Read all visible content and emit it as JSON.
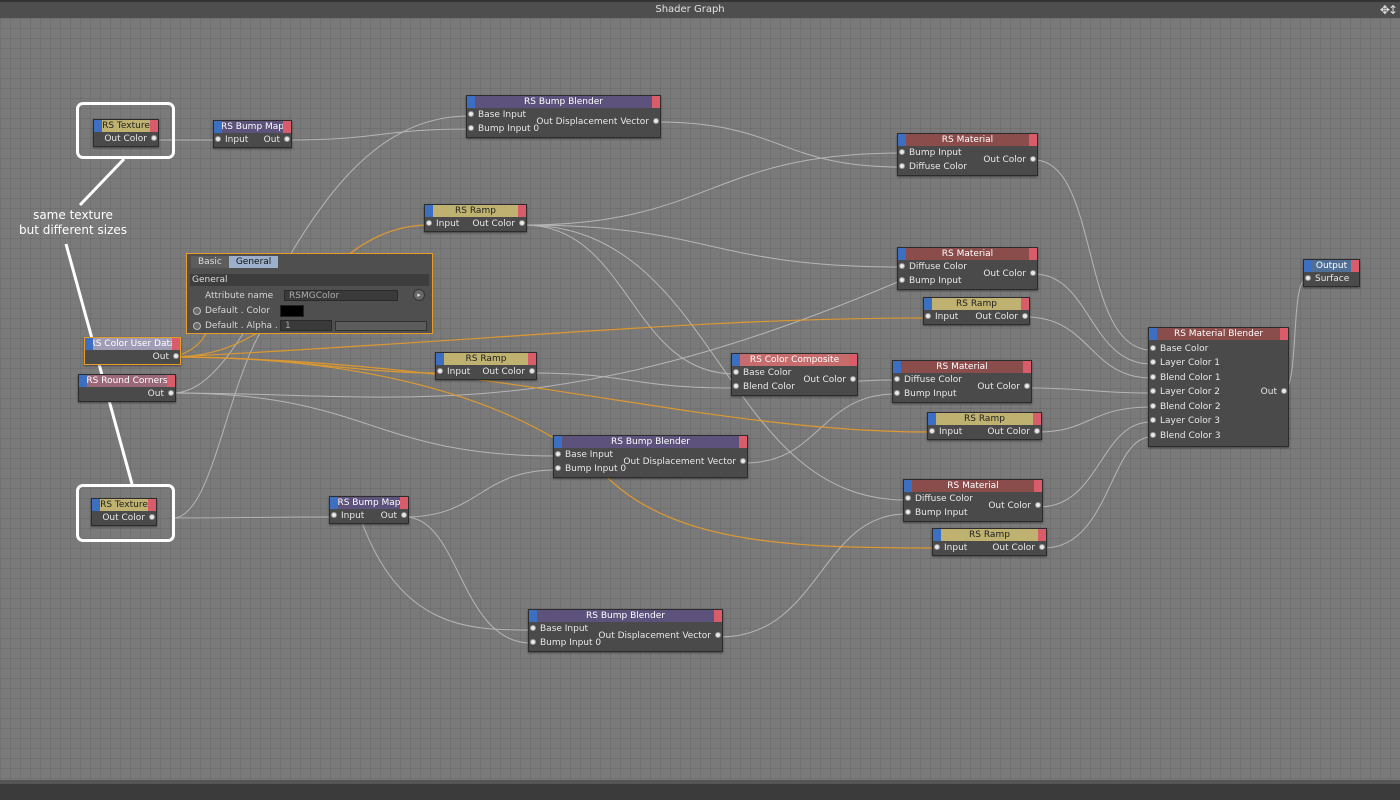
{
  "window": {
    "title": "Shader Graph"
  },
  "annotation": {
    "line1": "same texture",
    "line2": "but different sizes"
  },
  "attr_panel": {
    "tabs": [
      "Basic",
      "General"
    ],
    "section": "General",
    "attribute_name_label": "Attribute name",
    "attribute_name_value": "RSMGColor",
    "default_color_label": "Default . Color",
    "default_alpha_label": "Default . Alpha .",
    "default_alpha_value": "1"
  },
  "nodes": {
    "tex1": {
      "title": "RS Texture",
      "out": "Out Color"
    },
    "tex2": {
      "title": "RS Texture",
      "out": "Out Color"
    },
    "bumpmap1": {
      "title": "RS Bump Map",
      "in": "Input",
      "out": "Out"
    },
    "bumpmap2": {
      "title": "RS Bump Map",
      "in": "Input",
      "out": "Out"
    },
    "userdata": {
      "title": "RS Color User Data",
      "out": "Out"
    },
    "round": {
      "title": "RS Round Corners",
      "out": "Out"
    },
    "blender1": {
      "title": "RS Bump Blender",
      "in1": "Base Input",
      "in2": "Bump Input 0",
      "out": "Out Displacement Vector"
    },
    "blender2": {
      "title": "RS Bump Blender",
      "in1": "Base Input",
      "in2": "Bump Input 0",
      "out": "Out Displacement Vector"
    },
    "blender3": {
      "title": "RS Bump Blender",
      "in1": "Base Input",
      "in2": "Bump Input 0",
      "out": "Out Displacement Vector"
    },
    "ramp1": {
      "title": "RS Ramp",
      "in": "Input",
      "out": "Out Color"
    },
    "ramp2": {
      "title": "RS Ramp",
      "in": "Input",
      "out": "Out Color"
    },
    "ramp3": {
      "title": "RS Ramp",
      "in": "Input",
      "out": "Out Color"
    },
    "ramp4": {
      "title": "RS Ramp",
      "in": "Input",
      "out": "Out Color"
    },
    "ramp5": {
      "title": "RS Ramp",
      "in": "Input",
      "out": "Out Color"
    },
    "composite": {
      "title": "RS Color Composite",
      "in1": "Base Color",
      "in2": "Blend Color",
      "out": "Out Color"
    },
    "mat1": {
      "title": "RS Material",
      "in1": "Bump Input",
      "in2": "Diffuse Color",
      "out": "Out Color"
    },
    "mat2": {
      "title": "RS Material",
      "in1": "Diffuse Color",
      "in2": "Bump Input",
      "out": "Out Color"
    },
    "mat3": {
      "title": "RS Material",
      "in1": "Diffuse Color",
      "in2": "Bump Input",
      "out": "Out Color"
    },
    "mat4": {
      "title": "RS Material",
      "in1": "Diffuse Color",
      "in2": "Bump Input",
      "out": "Out Color"
    },
    "matblender": {
      "title": "RS Material Blender",
      "inputs": [
        "Base Color",
        "Layer Color 1",
        "Blend Color 1",
        "Layer Color 2",
        "Blend Color 2",
        "Layer Color 3",
        "Blend Color 3"
      ],
      "out": "Out"
    },
    "output": {
      "title": "Output",
      "in": "Surface"
    }
  },
  "colors": {
    "wire": "#c9c9c9",
    "selected_wire": "#e79c2a",
    "callout": "#ffffff"
  }
}
